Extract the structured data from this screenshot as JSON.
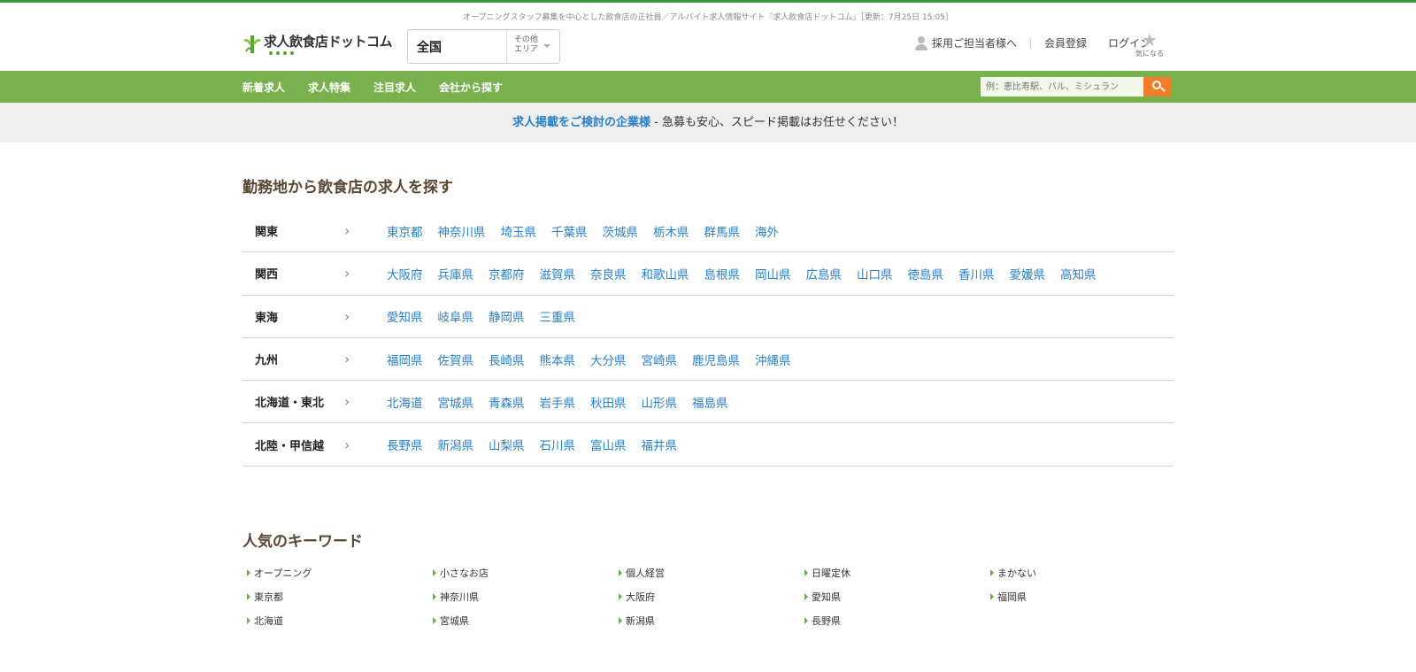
{
  "site": {
    "tagline": "オープニングスタッフ募集を中心とした飲食店の正社員／アルバイト求人情報サイト『求人飲食店ドットコム』［更新：7月25日 15:05］",
    "logo_text": "求人飲食店ドットコム"
  },
  "area_select": {
    "current": "全国",
    "other_line1": "その他",
    "other_line2": "エリア"
  },
  "header_links": {
    "recruiter": "採用ご担当者様へ",
    "register": "会員登録",
    "login": "ログイン",
    "favorite": "気になる"
  },
  "nav": {
    "items": [
      "新着求人",
      "求人特集",
      "注目求人",
      "会社から探す"
    ],
    "search_placeholder": "例：恵比寿駅、バル、ミシュラン"
  },
  "banner": {
    "highlight": "求人掲載をご検討の企業様",
    "text": " - 急募も安心、スピード掲載はお任せください！"
  },
  "regions_section": {
    "title": "勤務地から飲食店の求人を探す",
    "regions": [
      {
        "name": "関東",
        "prefs": [
          "東京都",
          "神奈川県",
          "埼玉県",
          "千葉県",
          "茨城県",
          "栃木県",
          "群馬県",
          "海外"
        ]
      },
      {
        "name": "関西",
        "prefs": [
          "大阪府",
          "兵庫県",
          "京都府",
          "滋賀県",
          "奈良県",
          "和歌山県",
          "島根県",
          "岡山県",
          "広島県",
          "山口県",
          "徳島県",
          "香川県",
          "愛媛県",
          "高知県"
        ]
      },
      {
        "name": "東海",
        "prefs": [
          "愛知県",
          "岐阜県",
          "静岡県",
          "三重県"
        ]
      },
      {
        "name": "九州",
        "prefs": [
          "福岡県",
          "佐賀県",
          "長崎県",
          "熊本県",
          "大分県",
          "宮崎県",
          "鹿児島県",
          "沖縄県"
        ]
      },
      {
        "name": "北海道・東北",
        "prefs": [
          "北海道",
          "宮城県",
          "青森県",
          "岩手県",
          "秋田県",
          "山形県",
          "福島県"
        ]
      },
      {
        "name": "北陸・甲信越",
        "prefs": [
          "長野県",
          "新潟県",
          "山梨県",
          "石川県",
          "富山県",
          "福井県"
        ]
      }
    ]
  },
  "keywords_section": {
    "title": "人気のキーワード",
    "keywords": [
      "オープニング",
      "小さなお店",
      "個人経営",
      "日曜定休",
      "まかない",
      "東京都",
      "神奈川県",
      "大阪府",
      "愛知県",
      "福岡県",
      "北海道",
      "宮城県",
      "新潟県",
      "長野県"
    ]
  },
  "colors": {
    "nav_green": "#7ab14f",
    "link_blue": "#2a7fc4",
    "search_orange": "#ef7d2a"
  }
}
